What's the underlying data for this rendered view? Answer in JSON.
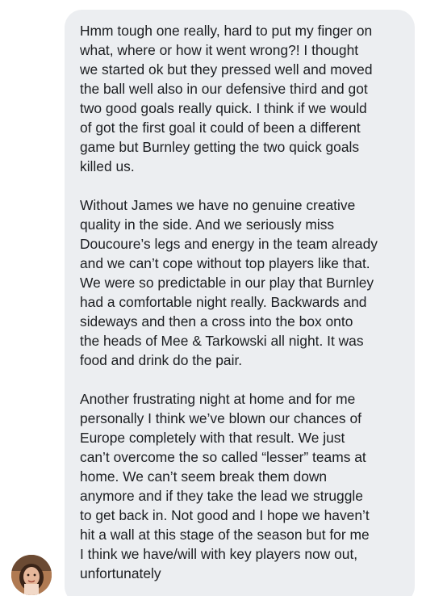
{
  "comment": {
    "paragraphs": [
      {
        "lines": [
          "Hmm tough one really, hard to put my finger on",
          "what, where or how it went wrong?! I thought",
          "we started ok but they pressed well and moved",
          "the ball well also in our defensive third and got",
          "two good goals really quick. I think if we would",
          "of got the first goal it could of been a different",
          "game but Burnley getting the two quick goals",
          "killed us."
        ]
      },
      {
        "lines": [
          "Without James we have no genuine creative",
          "quality in the side. And we seriously miss",
          "Doucoure’s legs and energy in the team already",
          "and we can’t cope without top players like that.",
          "We were so predictable in our play that Burnley",
          "had a comfortable night really. Backwards and",
          "sideways and then a cross into the box onto",
          "the heads of Mee & Tarkowski all night. It was",
          "food and drink do the pair."
        ]
      },
      {
        "lines": [
          "Another frustrating night at home and for me",
          "personally I think we’ve blown our chances of",
          "Europe completely with that result. We just",
          "can’t overcome the so called “lesser” teams at",
          "home. We can’t seem break them down",
          "anymore and if they take the lead we struggle",
          "to get back in. Not good and I hope we haven’t",
          "hit a wall at this stage of the season but for me",
          "I think we have/will with key players now out,",
          "unfortunately"
        ]
      }
    ]
  },
  "avatar": {
    "icon": "user-avatar-photo"
  },
  "colors": {
    "bubble_bg": "#eceef1",
    "text": "#1c1e21"
  }
}
